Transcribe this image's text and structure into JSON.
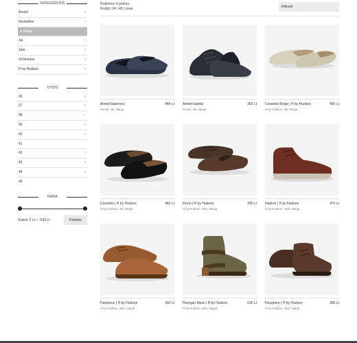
{
  "sidebar": {
    "categories_title": "KATEGORIJOS",
    "categories": [
      {
        "label": "Anniel",
        "active": false
      },
      {
        "label": "Nuolaidos",
        "active": false
      },
      {
        "label": "Nauja",
        "active": true
      },
      {
        "label": "Jai",
        "active": false
      },
      {
        "label": "Jam",
        "active": false
      },
      {
        "label": "Schmoove",
        "active": false
      },
      {
        "label": "H by Hudson",
        "active": false
      }
    ],
    "sizes_title": "DYDIS",
    "sizes": [
      {
        "label": "36",
        "chevron": true
      },
      {
        "label": "37",
        "chevron": true
      },
      {
        "label": "38",
        "chevron": true
      },
      {
        "label": "39",
        "chevron": true
      },
      {
        "label": "40",
        "chevron": true
      },
      {
        "label": "41",
        "chevron": false
      },
      {
        "label": "42",
        "chevron": true
      },
      {
        "label": "43",
        "chevron": true
      },
      {
        "label": "44",
        "chevron": true
      },
      {
        "label": "45",
        "chevron": false
      }
    ],
    "price_title": "KAINA",
    "price_range_text": "Kaina: 0 Lt — 630 Lt",
    "filter_button": "Pateikia"
  },
  "topbar": {
    "showing_text": "Rodomos 9 prekės",
    "view_text": "Rodyti: 24 / 48 / visas",
    "sort_label": "Rikiuoti"
  },
  "products": [
    {
      "name": "Anniel balerinos",
      "price": "444 Lt",
      "tags": "Anniel, Jai, Nauja",
      "shoe": "flat-navy"
    },
    {
      "name": "Anniel batelai",
      "price": "355 Lt",
      "tags": "Anniel, Jai, Nauja",
      "shoe": "lace-dark"
    },
    {
      "name": "Cossette Beige | H by Hudson",
      "price": "450 Lt",
      "tags": "H by Hudson, Jai, Nauja",
      "shoe": "slipper-beige"
    },
    {
      "name": "Cossette | H by Hudson",
      "price": "460 Lt",
      "tags": "H by Hudson, Jai, Nauja",
      "shoe": "loafer-black"
    },
    {
      "name": "Florio | H by Hudson",
      "price": "320 Lt",
      "tags": "H by Hudson, Jam, Nauja",
      "shoe": "driver-brown"
    },
    {
      "name": "Hadron | H by Hudson",
      "price": "470 Lt",
      "tags": "H by Hudson, Jam, Nauja",
      "shoe": "chukka-brown"
    },
    {
      "name": "Hadstone | H by Hudson",
      "price": "360 Lt",
      "tags": "H by Hudson, Jam, Nauja",
      "shoe": "derby-tan"
    },
    {
      "name": "Horrigan Moss | H by Hudson",
      "price": "630 Lt",
      "tags": "H by Hudson, Jam, Nauja",
      "shoe": "boot-moss"
    },
    {
      "name": "Houghton | H by Hudson",
      "price": "380 Lt",
      "tags": "H by Hudson, Jam, Nauja",
      "shoe": "chukka-suede"
    }
  ],
  "colors": {
    "active_category_bg": "#b9b9b9",
    "search_bg": "#ebebeb",
    "card_bg": "#f4f4f4",
    "footer": "#444444"
  }
}
